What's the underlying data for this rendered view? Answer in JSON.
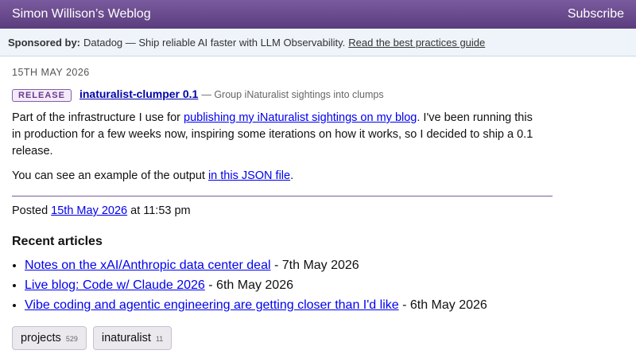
{
  "header": {
    "site_title": "Simon Willison’s Weblog",
    "subscribe_label": "Subscribe"
  },
  "sponsor": {
    "label": "Sponsored by:",
    "text": "Datadog — Ship reliable AI faster with LLM Observability.",
    "link_text": "Read the best practices guide"
  },
  "post": {
    "date": "15TH MAY 2026",
    "badge": "RELEASE",
    "release_name": "inaturalist-clumper 0.1",
    "release_desc": "— Group iNaturalist sightings into clumps",
    "para1_pre": "Part of the infrastructure I use for ",
    "para1_link": "publishing my iNaturalist sightings on my blog",
    "para1_post": ". I've been running this in production for a few weeks now, inspiring some iterations on how it works, so I decided to ship a 0.1 release.",
    "para2_pre": "You can see an example of the output ",
    "para2_link": "in this JSON file",
    "para2_post": ".",
    "posted_pre": "Posted ",
    "posted_link": "15th May 2026",
    "posted_post": " at 11:53 pm"
  },
  "recent": {
    "heading": "Recent articles",
    "items": [
      {
        "title": "Notes on the xAI/Anthropic data center deal",
        "date": " - 7th May 2026"
      },
      {
        "title": "Live blog: Code w/ Claude 2026",
        "date": " - 6th May 2026"
      },
      {
        "title": "Vibe coding and agentic engineering are getting closer than I'd like",
        "date": " - 6th May 2026"
      }
    ]
  },
  "tags": [
    {
      "name": "projects",
      "count": "529"
    },
    {
      "name": "inaturalist",
      "count": "11"
    }
  ]
}
